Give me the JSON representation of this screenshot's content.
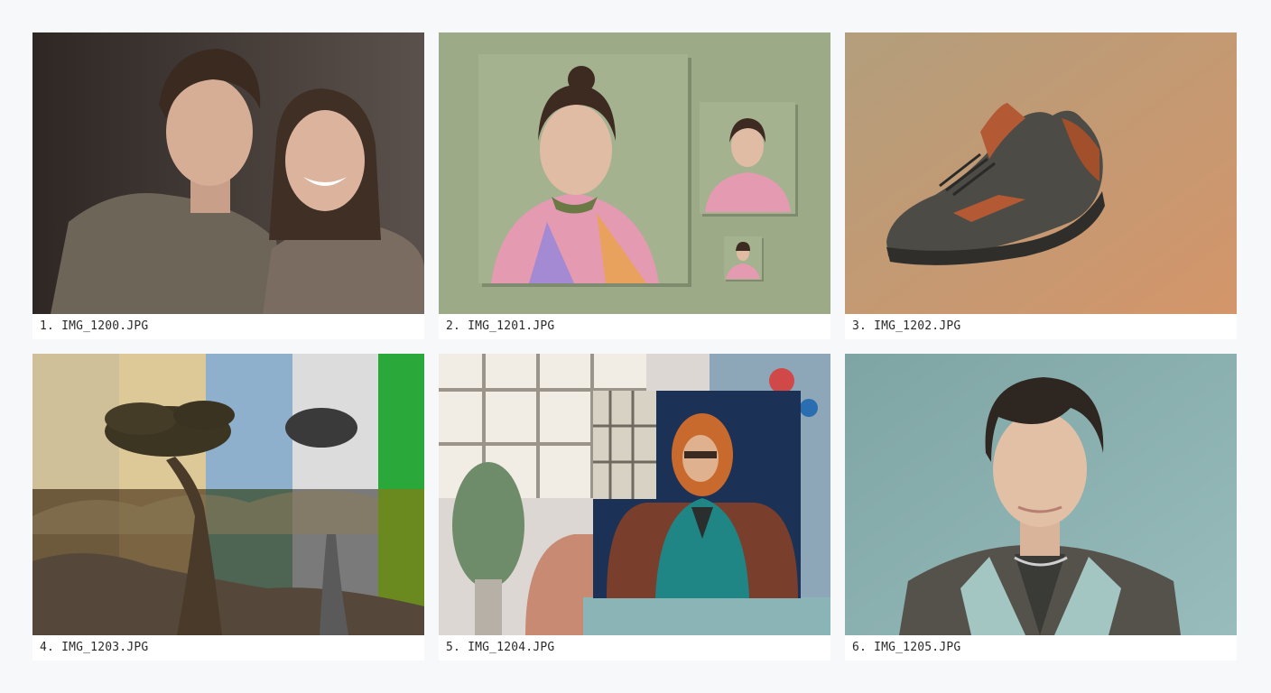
{
  "gallery": {
    "items": [
      {
        "caption": "1. IMG_1200.JPG",
        "thumb_icon": "two-people-portrait-photo"
      },
      {
        "caption": "2. IMG_1201.JPG",
        "thumb_icon": "nested-portrait-frames-photo"
      },
      {
        "caption": "3. IMG_1202.JPG",
        "thumb_icon": "sneaker-product-photo"
      },
      {
        "caption": "4. IMG_1203.JPG",
        "thumb_icon": "tree-color-grading-strips-photo"
      },
      {
        "caption": "5. IMG_1204.JPG",
        "thumb_icon": "woman-in-armchair-collage-photo"
      },
      {
        "caption": "6. IMG_1205.JPG",
        "thumb_icon": "man-portrait-photo"
      }
    ]
  },
  "colors": {
    "page_background": "#f7f8fa",
    "caption_background": "#ffffff",
    "caption_text": "#2a2a2a"
  }
}
